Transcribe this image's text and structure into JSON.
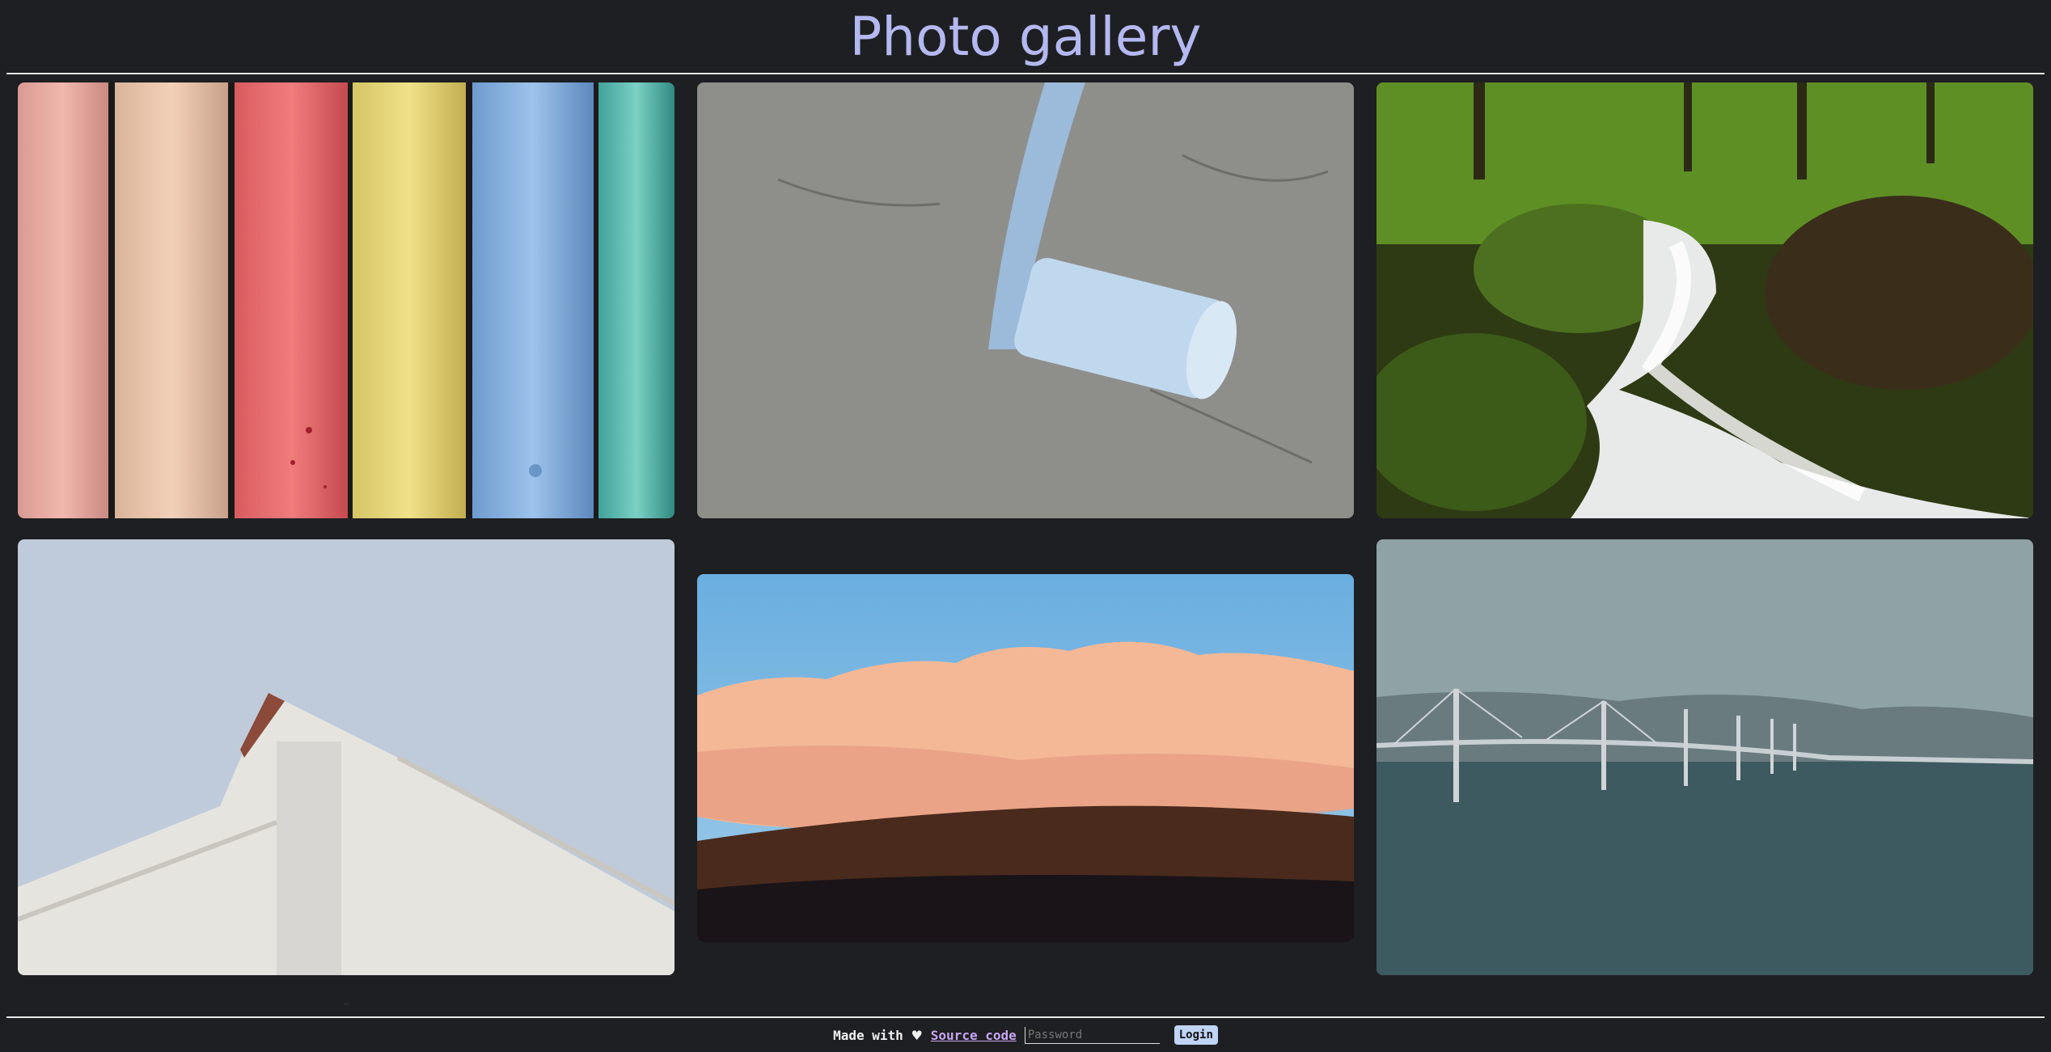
{
  "page": {
    "title": "Photo gallery"
  },
  "gallery": {
    "photos": [
      {
        "name": "photo-chalk-sticks",
        "subject": "colored chalk sticks"
      },
      {
        "name": "photo-blue-chalk",
        "subject": "blue chalk on pavement"
      },
      {
        "name": "photo-forest-stream",
        "subject": "forest stream"
      },
      {
        "name": "photo-white-building",
        "subject": "white building roof"
      },
      {
        "name": "photo-pink-clouds",
        "subject": "pink clouds over mountains"
      },
      {
        "name": "photo-bridge",
        "subject": "cable-stayed bridge over water"
      }
    ]
  },
  "footer": {
    "made_with": "Made with",
    "heart": "♥",
    "source_label": "Source code",
    "password_placeholder": "Password",
    "login_label": "Login"
  },
  "colors": {
    "background": "#1e1f22",
    "title": "#b4b8f0",
    "link": "#c8a6f2",
    "login_button": "#c0d4f5"
  }
}
